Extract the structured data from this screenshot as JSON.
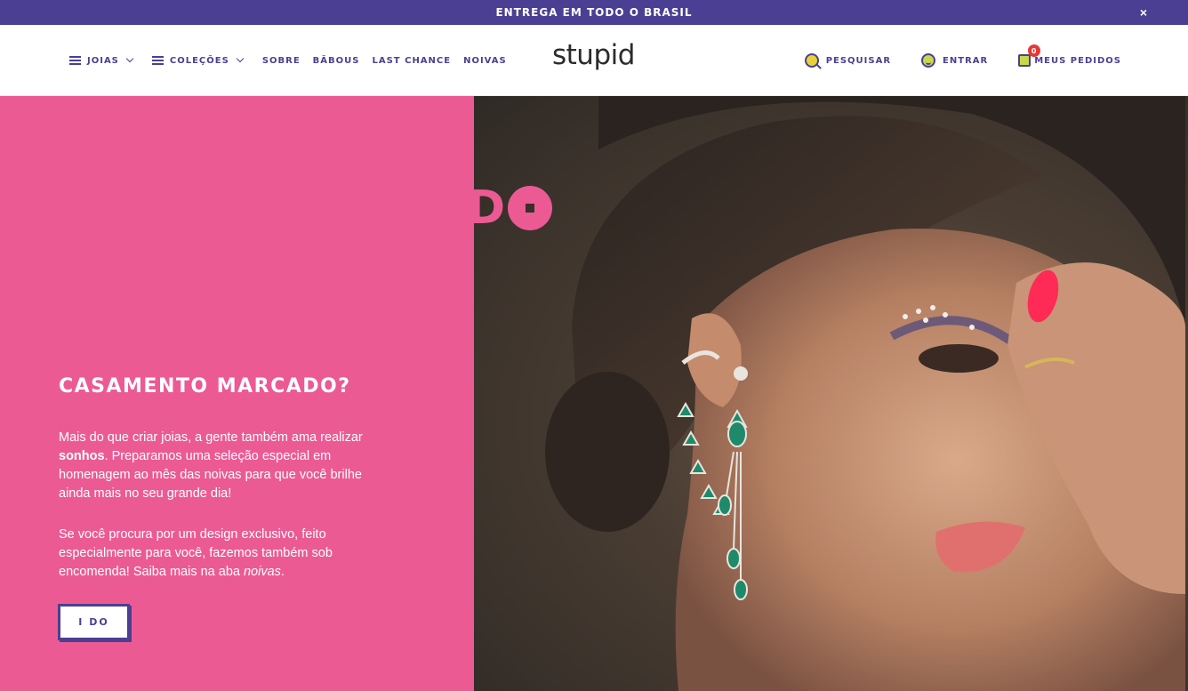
{
  "announcement": {
    "text": "ENTREGA EM TODO O BRASIL",
    "close": "×"
  },
  "header": {
    "nav_left": [
      {
        "label": "JOIAS",
        "menu": true,
        "dropdown": true
      },
      {
        "label": "COLEÇÕES",
        "menu": true,
        "dropdown": true
      },
      {
        "label": "SOBRE"
      },
      {
        "label": "BÃBOUS"
      },
      {
        "label": "LAST CHANCE"
      },
      {
        "label": "NOIVAS"
      }
    ],
    "logo": "stupid",
    "nav_right": {
      "search": "PESQUISAR",
      "login": "ENTRAR",
      "orders": "MEUS PEDIDOS",
      "cart_count": "0"
    }
  },
  "hero": {
    "title": "CASAMENTO MARCADO?",
    "p1_pre": "Mais do que criar joias, a gente também ama realizar ",
    "p1_bold": "sonhos",
    "p1_post": ". Preparamos uma seleção especial em homenagem ao mês das noivas para que você brilhe ainda mais no seu grande dia!",
    "p2_pre": "Se você procura por um design exclusivo, feito especialmente para você, fazemos também sob encomenda! Saiba mais na aba ",
    "p2_italic": "noivas",
    "p2_post": ".",
    "button": "I DO",
    "image_overlay_text": "D"
  },
  "colors": {
    "brand_purple": "#4b3f93",
    "hero_pink": "#ec5a94",
    "badge_red": "#e53935"
  }
}
